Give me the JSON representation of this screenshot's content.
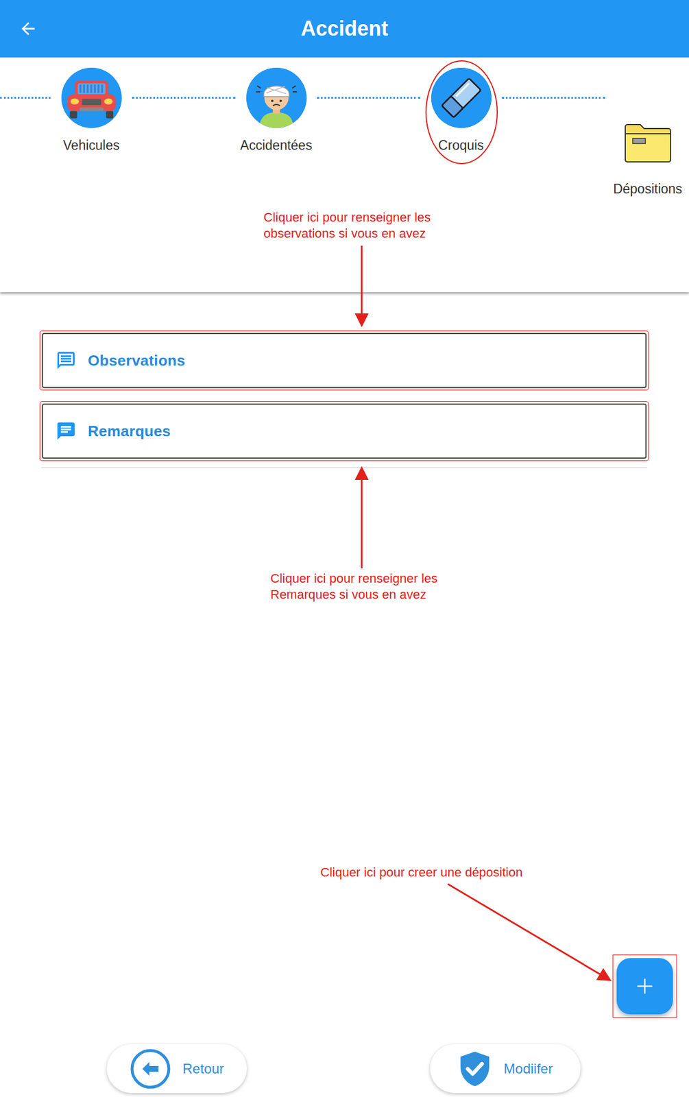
{
  "header": {
    "title": "Accident"
  },
  "steps": [
    {
      "label": "Vehicules",
      "kind": "circle",
      "highlighted": false
    },
    {
      "label": "Accidentées",
      "kind": "circle",
      "highlighted": false
    },
    {
      "label": "Croquis",
      "kind": "circle",
      "highlighted": true
    },
    {
      "label": "Dépositions",
      "kind": "folder",
      "highlighted": false
    }
  ],
  "fields": [
    {
      "label": "Observations",
      "kind": "outline",
      "highlighted": true
    },
    {
      "label": "Remarques",
      "kind": "filled",
      "highlighted": true
    }
  ],
  "annotations": [
    {
      "lines": [
        "Cliquer ici pour renseigner les",
        "observations si vous en avez"
      ]
    },
    {
      "lines": [
        "Cliquer ici pour renseigner les",
        "Remarques si vous en avez"
      ]
    },
    {
      "lines": [
        "Cliquer ici pour creer une déposition"
      ]
    }
  ],
  "fab": {
    "highlighted": true
  },
  "buttons": [
    {
      "label": "Retour",
      "kind": "back"
    },
    {
      "label": "Modiifer",
      "kind": "confirm"
    }
  ]
}
